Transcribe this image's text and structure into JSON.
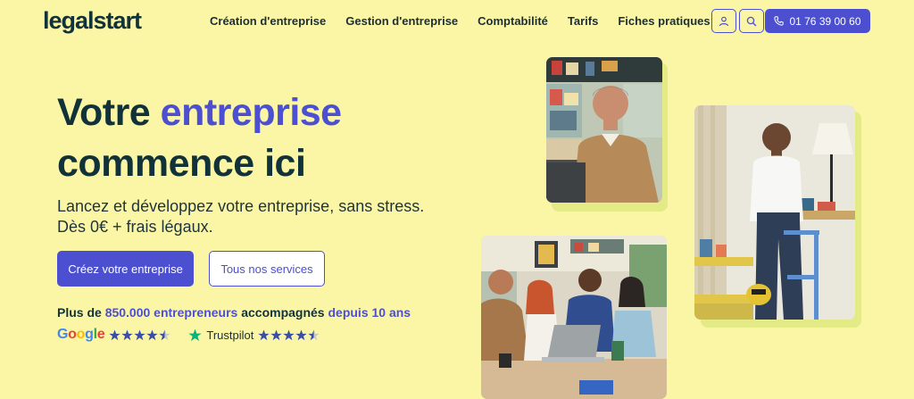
{
  "brand": {
    "logo_text": "legalstart"
  },
  "nav": {
    "items": [
      "Création d'entreprise",
      "Gestion d'entreprise",
      "Comptabilité",
      "Tarifs",
      "Fiches pratiques"
    ]
  },
  "header": {
    "phone": "01 76 39 00 60"
  },
  "hero": {
    "title_part1": "Votre ",
    "title_accent": "entreprise",
    "title_part2": "commence ici",
    "subtitle_line1": "Lancez et développez votre entreprise, sans stress.",
    "subtitle_line2": "Dès 0€ + frais légaux.",
    "cta_primary": "Créez votre entreprise",
    "cta_secondary": "Tous nos services",
    "stats": {
      "prefix": "Plus de ",
      "count": "850.000 entrepreneurs",
      "middle": " accompagnés ",
      "duration": "depuis 10 ans"
    }
  },
  "ratings": {
    "google": {
      "letters": [
        "G",
        "o",
        "o",
        "g",
        "l",
        "e"
      ],
      "stars": 4.5
    },
    "trustpilot": {
      "label": "Trustpilot",
      "stars": 4.5
    }
  },
  "colors": {
    "background": "#fbf6a6",
    "accent": "#4b4fd0",
    "text": "#12323a",
    "trustpilot_green": "#00b67a"
  },
  "icons": [
    "user-icon",
    "search-icon",
    "phone-icon",
    "star-icon",
    "trustpilot-star-icon"
  ]
}
